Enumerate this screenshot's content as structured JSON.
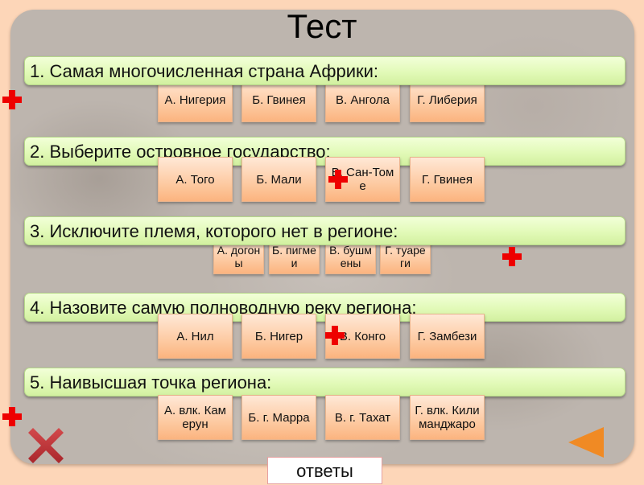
{
  "title": "Тест",
  "questions": [
    {
      "text": "1. Самая многочисленная страна Африки:",
      "options": [
        "А. Нигерия",
        "Б. Гвинея",
        "В. Ангола",
        "Г. Либерия"
      ]
    },
    {
      "text": "2. Выберите островное государство:",
      "options": [
        "А.  Того",
        "Б. Мали",
        "В. Сан-Томе",
        "Г. Гвинея"
      ]
    },
    {
      "text": "3. Исключите племя, которого нет в регионе:",
      "options": [
        "А. догоны",
        "Б. пигмеи",
        "В. бушмены",
        "Г. туареги"
      ]
    },
    {
      "text": "4. Назовите самую полноводную реку региона:",
      "options": [
        "А. Нил",
        "Б. Нигер",
        "В. Конго",
        "Г. Замбези"
      ]
    },
    {
      "text": "5. Наивысшая точка региона:",
      "options": [
        "А. влк. Камерун",
        "Б. г. Марра",
        "В. г. Тахат",
        "Г. влк. Килиманджаро"
      ]
    }
  ],
  "answers_button": "ответы",
  "icons": {
    "close": "close-x-icon",
    "next": "triangle-left-icon",
    "marker": "plus-icon"
  },
  "colors": {
    "background": "#fdd6b8",
    "panel": "#bdb5ae",
    "question_bar": "#e2fab8",
    "option": "#fdcaa2",
    "marker": "#ee0000",
    "close": "#c0363a",
    "next": "#f08a24"
  }
}
